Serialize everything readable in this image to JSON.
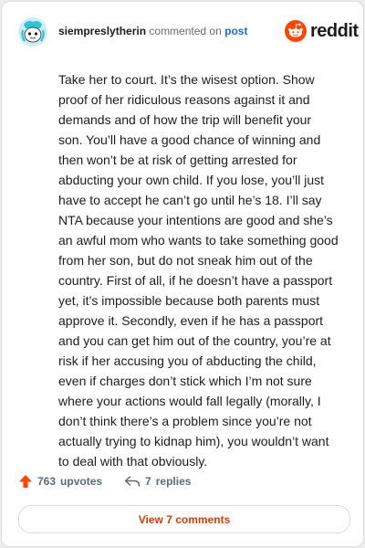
{
  "header": {
    "username": "siempreslytherin",
    "action_text": "commented on",
    "post_link": "post",
    "logo_text": "reddit"
  },
  "comment": {
    "lines": [
      "Take her to court. It’s the wisest option. Show",
      "proof of her ridiculous reasons against it and",
      "demands and of how the trip will benefit your",
      "son. You’ll have a good chance of winning and",
      "then won’t be at risk of getting arrested for",
      "abducting your own child. If you lose, you’ll just",
      "have to accept he can’t go until he’s 18. I’ll say",
      "NTA because your intentions are good and she’s",
      "an awful mom who wants to take something good",
      "from her son, but do not sneak him out of the",
      "country. First of all, if he doesn’t have a passport",
      "yet, it’s impossible because both parents must",
      "approve it. Secondly, even if he has a passport",
      "and you can get him out of the country, you’re at",
      "risk if her accusing you of abducting the child,",
      "even if charges don’t stick which I’m not sure",
      "where your actions would fall legally (morally, I",
      "don’t think there’s a problem since you’re not",
      "actually trying to kidnap him), you wouldn’t want",
      "to deal with that obviously."
    ]
  },
  "actions": {
    "upvote_count": "763",
    "upvote_label": "upvotes",
    "reply_count": "7",
    "reply_label": "replies",
    "view_button": "View 7 comments"
  },
  "icons": {
    "upvote": "upvote-arrow-icon",
    "reply": "reply-arrow-icon",
    "logo": "reddit-snoo-icon",
    "avatar": "avatar"
  },
  "colors": {
    "accent_orange": "#d93a00",
    "reddit_orange": "#ff4500",
    "link_blue": "#1d6dc9",
    "upvote_orange": "#ff4500"
  }
}
